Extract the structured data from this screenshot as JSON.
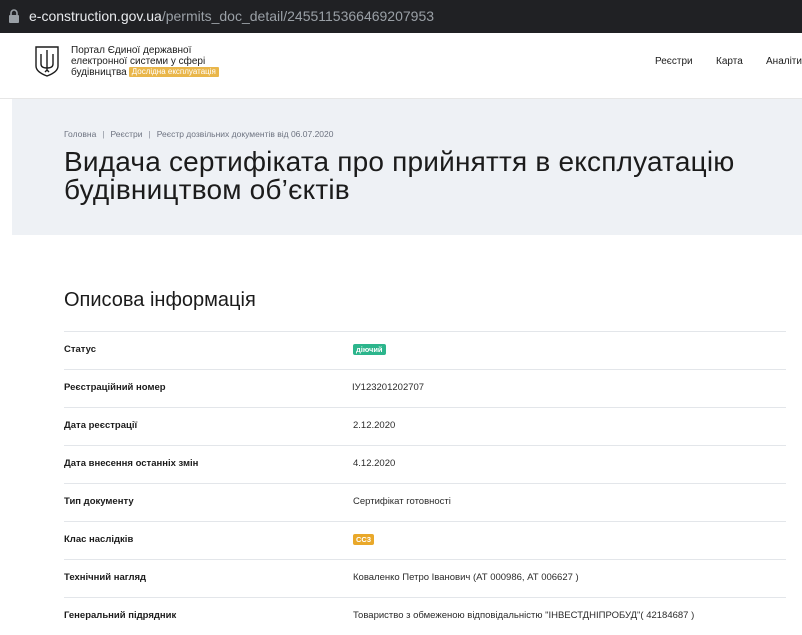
{
  "browser": {
    "url_host": "e-construction.gov.ua",
    "url_path": "/permits_doc_detail/2455115366469207953"
  },
  "header": {
    "portal_line1": "Портал Єдиної державної",
    "portal_line2": "електронної системи у сфері",
    "portal_line3": "будівництва",
    "beta_badge": "Дослідна експлуатація",
    "nav": [
      "Реєстри",
      "Карта",
      "Аналіти"
    ]
  },
  "breadcrumb": [
    "Головна",
    "Реєстри",
    "Реєстр дозвільних документів від 06.07.2020"
  ],
  "page_title_line1": "Видача сертифіката про прийняття в експлуатацію",
  "page_title_line2": "будівництвом об’єктів",
  "section_title": "Описова інформація",
  "rows": [
    {
      "label": "Статус",
      "value": "діючий"
    },
    {
      "label": "Реєстраційний номер",
      "value": "ІУ123201202707"
    },
    {
      "label": "Дата реєстрації",
      "value": "2.12.2020"
    },
    {
      "label": "Дата внесення останніх змін",
      "value": "4.12.2020"
    },
    {
      "label": "Тип документу",
      "value": "Сертифікат готовності"
    },
    {
      "label": "Клас наслідків",
      "value": "СС3"
    },
    {
      "label": "Технічний нагляд",
      "value": "Коваленко Петро Іванович (АТ 000986, АТ 006627 )"
    },
    {
      "label": "Генеральний підрядник",
      "value": "Товариство з обмеженою відповідальністю \"ІНВЕСТДНІПРОБУД\"( 42184687 )"
    }
  ],
  "colors": {
    "status_badge": "#2cb58c",
    "class_badge": "#e9a82a",
    "beta_badge": "#e9b64a",
    "hero_bg": "#eef1f5"
  }
}
